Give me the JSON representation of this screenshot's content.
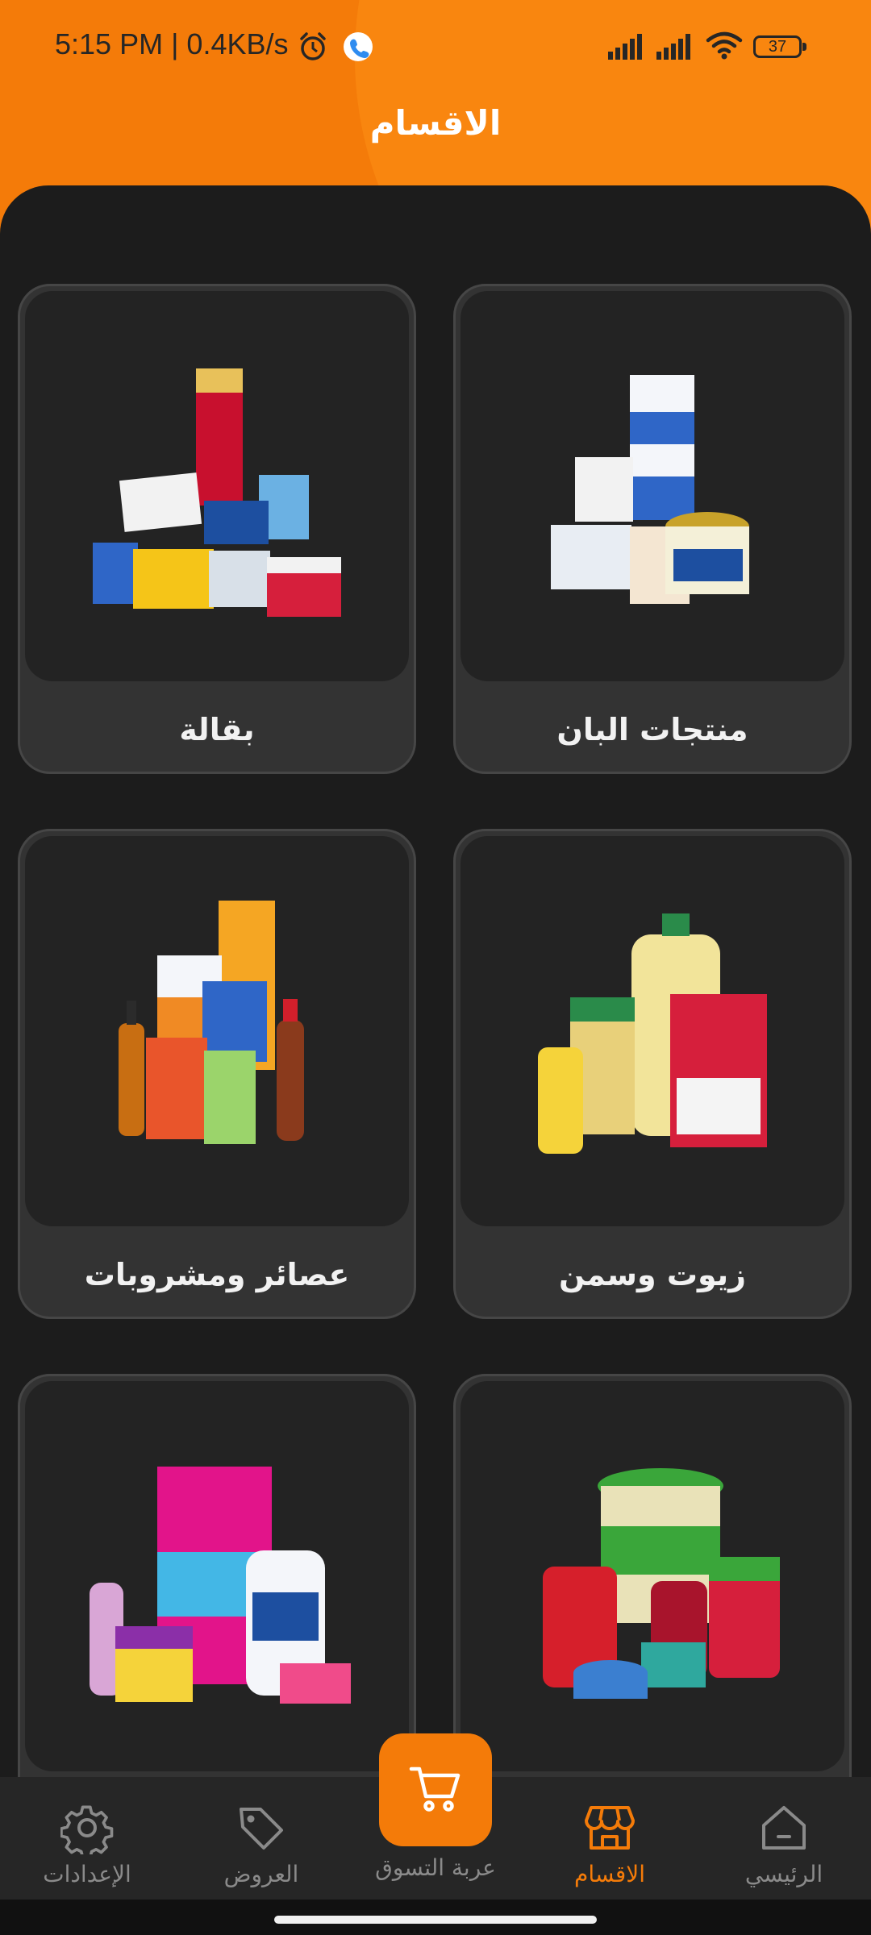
{
  "status_bar": {
    "time": "5:15 PM | 0.4KB/s",
    "battery": "37"
  },
  "header": {
    "title": "الاقسام"
  },
  "categories": [
    {
      "label": "بقالة",
      "icon": "grocery-products-image"
    },
    {
      "label": "منتجات البان",
      "icon": "dairy-products-image"
    },
    {
      "label": "عصائر ومشروبات",
      "icon": "juices-drinks-image"
    },
    {
      "label": "زيوت وسمن",
      "icon": "oils-ghee-image"
    },
    {
      "label": "",
      "icon": "cleaning-products-image"
    },
    {
      "label": "",
      "icon": "canned-food-image"
    }
  ],
  "bottom_nav": {
    "settings": "الإعدادات",
    "offers": "العروض",
    "cart": "عربة التسوق",
    "categories": "الاقسام",
    "home": "الرئيسي"
  },
  "colors": {
    "accent": "#f47b09",
    "background": "#1c1c1c",
    "card": "#333333"
  }
}
